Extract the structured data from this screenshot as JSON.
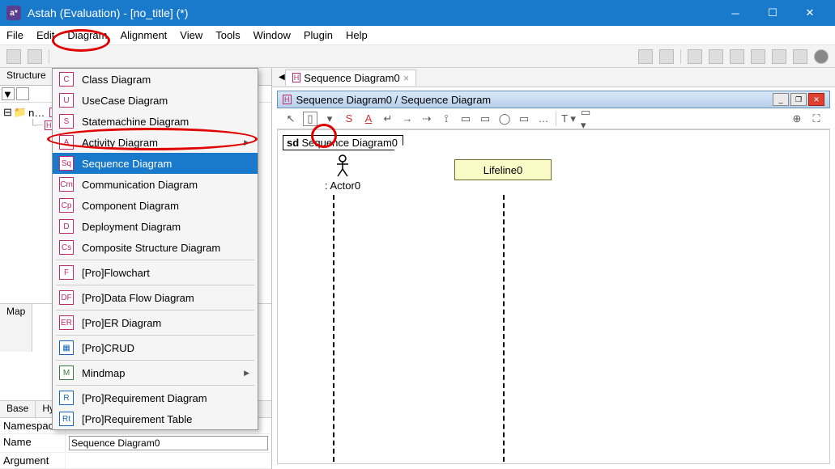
{
  "window": {
    "title": "Astah (Evaluation) - [no_title] (*)",
    "app_glyph": "a*"
  },
  "menubar": [
    "File",
    "Edit",
    "Diagram",
    "Alignment",
    "View",
    "Tools",
    "Window",
    "Plugin",
    "Help"
  ],
  "diagram_menu": {
    "items": [
      {
        "label": "Class Diagram",
        "icon": "C"
      },
      {
        "label": "UseCase Diagram",
        "icon": "U"
      },
      {
        "label": "Statemachine Diagram",
        "icon": "S"
      },
      {
        "label": "Activity Diagram",
        "icon": "A",
        "submenu": true
      },
      {
        "label": "Sequence Diagram",
        "icon": "Sq",
        "highlighted": true
      },
      {
        "label": "Communication Diagram",
        "icon": "Cm"
      },
      {
        "label": "Component Diagram",
        "icon": "Cp"
      },
      {
        "label": "Deployment Diagram",
        "icon": "D"
      },
      {
        "label": "Composite Structure Diagram",
        "icon": "Cs"
      },
      {
        "label": "sep"
      },
      {
        "label": "[Pro]Flowchart",
        "icon": "F"
      },
      {
        "label": "sep"
      },
      {
        "label": "[Pro]Data Flow Diagram",
        "icon": "DF"
      },
      {
        "label": "sep"
      },
      {
        "label": "[Pro]ER Diagram",
        "icon": "ER"
      },
      {
        "label": "sep"
      },
      {
        "label": "[Pro]CRUD",
        "icon": "▦",
        "alt": "alt2"
      },
      {
        "label": "sep"
      },
      {
        "label": "Mindmap",
        "icon": "M",
        "alt": "alt",
        "submenu": true
      },
      {
        "label": "sep"
      },
      {
        "label": "[Pro]Requirement Diagram",
        "icon": "R",
        "alt": "alt2"
      },
      {
        "label": "[Pro]Requirement Table",
        "icon": "Rt",
        "alt": "alt2"
      }
    ]
  },
  "left_panel": {
    "structure_tab": "Structure",
    "map_tab": "Map",
    "tree_root": "n…",
    "base_tab": "Base",
    "hyp_tab": "Hyp",
    "namespace_label": "Namespace",
    "name_label": "Name",
    "name_value": "Sequence Diagram0",
    "argument_label": "Argument"
  },
  "canvas": {
    "tab_label": "Sequence Diagram0",
    "titlebar": "Sequence Diagram0 / Sequence Diagram",
    "diagram_tag_prefix": "sd",
    "diagram_tag_name": "Sequence Diagram0",
    "actor_label": ": Actor0",
    "lifeline_label": "Lifeline0"
  }
}
